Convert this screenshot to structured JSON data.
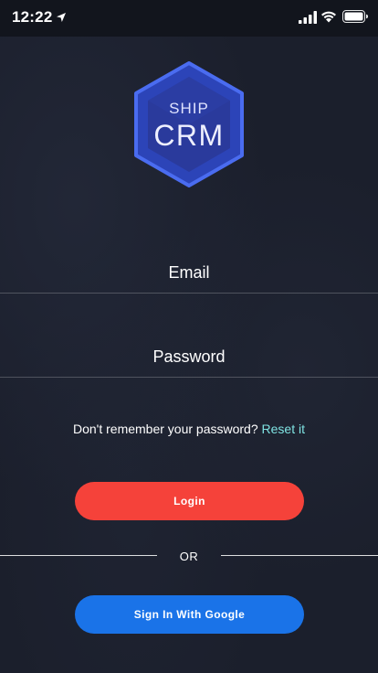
{
  "status_bar": {
    "time": "12:22",
    "icons": [
      "location-arrow-icon",
      "signal-icon",
      "wifi-icon",
      "battery-icon"
    ]
  },
  "logo": {
    "line1": "SHIP",
    "line2": "CRM",
    "colors": {
      "outer": "#3a5bd9",
      "inner": "#2b3fa5"
    }
  },
  "form": {
    "email_placeholder": "Email",
    "email_value": "",
    "password_placeholder": "Password",
    "password_value": ""
  },
  "forgot": {
    "text": "Don't remember your password?",
    "link": "Reset it"
  },
  "buttons": {
    "login": "Login",
    "divider": "OR",
    "google": "Sign In With Google"
  },
  "colors": {
    "background": "#1b1f2c",
    "login_button": "#f5423a",
    "google_button": "#1a73e8",
    "reset_link": "#7fe3e2"
  }
}
